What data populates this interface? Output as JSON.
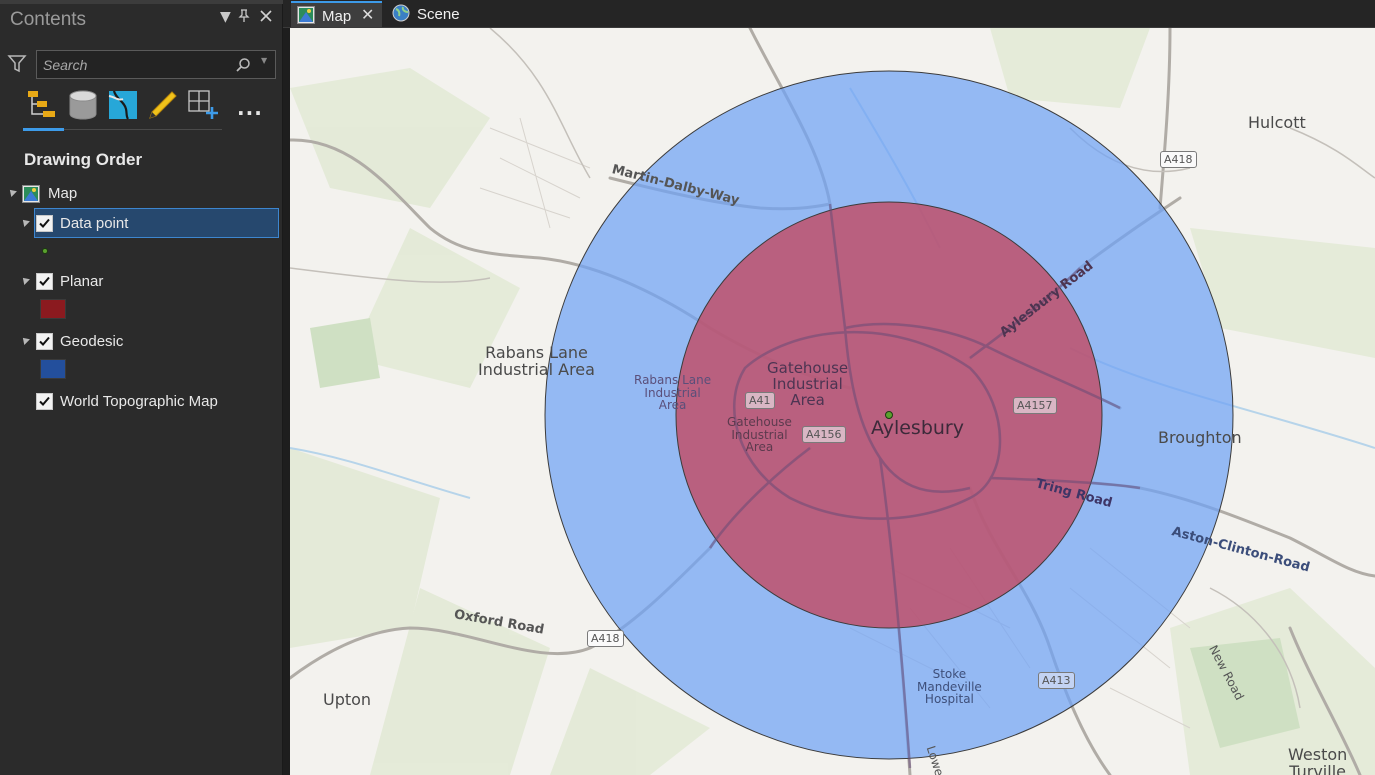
{
  "contents_pane": {
    "title": "Contents",
    "search_placeholder": "Search",
    "section_title": "Drawing Order",
    "layers": [
      {
        "label": "Map",
        "swatch": null
      },
      {
        "label": "Data point",
        "checked": true,
        "swatch": "point",
        "swatch_color": "#5aa12e",
        "selected": true
      },
      {
        "label": "Planar",
        "checked": true,
        "swatch_color": "#8b1a1f"
      },
      {
        "label": "Geodesic",
        "checked": true,
        "swatch_color": "#234f9c"
      },
      {
        "label": "World Topographic Map",
        "checked": true
      }
    ],
    "tools": [
      "list-by-drawing-order-icon",
      "list-by-source-icon",
      "list-by-selection-icon",
      "list-by-editing-icon",
      "list-by-snapping-icon"
    ],
    "more_label": "..."
  },
  "tabs": [
    {
      "label": "Map",
      "active": true,
      "close_label": "✕"
    },
    {
      "label": "Scene",
      "active": false
    }
  ],
  "map": {
    "places": {
      "hulcott": "Hulcott",
      "rabans": "Rabans Lane\nIndustrial Area",
      "rabans_small": "Rabans Lane\nIndustrial\nArea",
      "gatehouse": "Gatehouse\nIndustrial\nArea",
      "gatehouse_small": "Gatehouse\nIndustrial\nArea",
      "aylesbury": "Aylesbury",
      "broughton": "Broughton",
      "upton": "Upton",
      "stoke": "Stoke\nMandeville\nHospital",
      "weston": "Weston\nTurville"
    },
    "roads": {
      "martin_dalby": "Martin-Dalby-Way",
      "aylesbury_road": "Aylesbury Road",
      "tring_road": "Tring Road",
      "aston_clinton": "Aston-Clinton-Road",
      "oxford_road": "Oxford Road",
      "new_road": "New Road",
      "lower": "Lower"
    },
    "shields": {
      "a418_top": "A418",
      "a41": "A41",
      "a4156": "A4156",
      "a4157": "A4157",
      "a418_bottom": "A418",
      "a413": "A413"
    },
    "colors": {
      "geodesic_fill": "#6fa2f5",
      "planar_fill": "#c0506a",
      "data_point": "#5aa12e"
    }
  }
}
